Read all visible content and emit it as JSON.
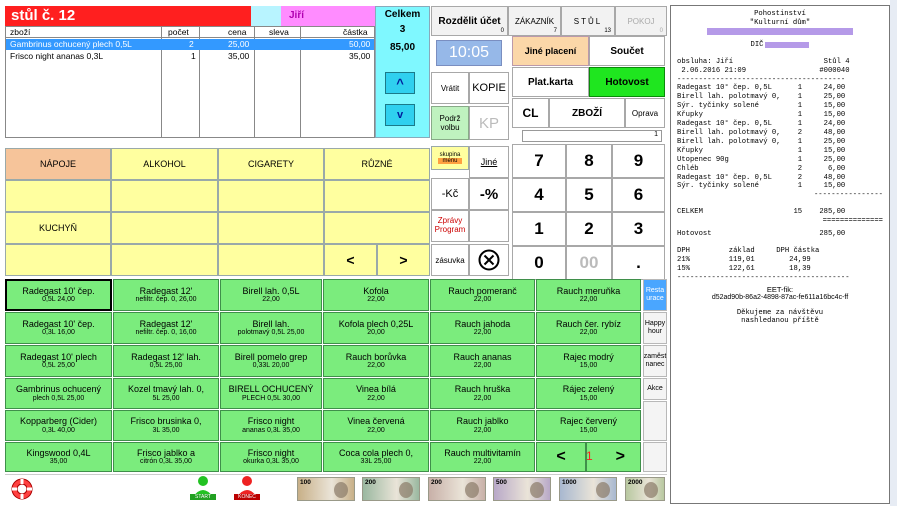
{
  "table": {
    "title": "stůl č. 12",
    "waiter": "Jiří",
    "total_label": "Celkem",
    "total_count": "3",
    "total_amount": "85,00"
  },
  "order": {
    "headers": [
      "zboží",
      "počet",
      "cena",
      "sleva",
      "částka"
    ],
    "rows": [
      [
        "Gambrinus ochucený plech 0,5L",
        "2",
        "25,00",
        "",
        "50,00"
      ],
      [
        "Frisco night ananas 0,3L",
        "1",
        "35,00",
        "",
        "35,00"
      ]
    ]
  },
  "clock": "10:05",
  "top_tabs": [
    {
      "label": "Rozdělit účet",
      "count": "0"
    },
    {
      "label": "ZÁKAZNÍK",
      "count": "7"
    },
    {
      "label": "STŮL",
      "count": "13"
    },
    {
      "label": "POKOJ",
      "count": "0"
    }
  ],
  "actions": {
    "jine_placeni": "Jiné placení",
    "soucet": "Součet",
    "plat_karta": "Plat.karta",
    "hotovost": "Hotovost",
    "vratit": "Vrátit",
    "kopie": "KOPIE",
    "podrz": "Podrž volbu",
    "kp": "KP",
    "cl": "CL",
    "zbozi": "ZBOŽÍ",
    "oprava": "Oprava",
    "skupina": "skupina",
    "menu": "menu",
    "jine": "Jiné",
    "minus_kc": "-Kč",
    "percent": "-%",
    "zpravy": "Zprávy Program",
    "zasuvka": "zásuvka",
    "input_value": "1",
    "up": "^",
    "down": "v",
    "prev": "<",
    "next": ">"
  },
  "categories": [
    "NÁPOJE",
    "ALKOHOL",
    "CIGARETY",
    "RŮZNÉ",
    "KUCHYŇ"
  ],
  "keypad": [
    "7",
    "8",
    "9",
    "4",
    "5",
    "6",
    "1",
    "2",
    "3",
    "0",
    "00",
    "."
  ],
  "products": [
    [
      {
        "n": "Radegast 10' čep.",
        "s": "0,5L   24,00"
      },
      {
        "n": "Radegast 12'",
        "s": "nefiltr. čep. 0,    26,00"
      },
      {
        "n": "Birell lah. 0,5L",
        "s": "22,00"
      },
      {
        "n": "Kofola",
        "s": "22,00"
      },
      {
        "n": "Rauch pomeranč",
        "s": "22,00"
      },
      {
        "n": "Rauch meruňka",
        "s": "22,00"
      }
    ],
    [
      {
        "n": "Radegast 10' čep.",
        "s": "0,3L   16,00"
      },
      {
        "n": "Radegast 12'",
        "s": "nefiltr. čep. 0,    16,00"
      },
      {
        "n": "Birell lah.",
        "s": "polotmavý 0,5L    25,00"
      },
      {
        "n": "Kofola plech 0,25L",
        "s": "20,00"
      },
      {
        "n": "Rauch jahoda",
        "s": "22,00"
      },
      {
        "n": "Rauch čer. rybíz",
        "s": "22,00"
      }
    ],
    [
      {
        "n": "Radegast 10' plech",
        "s": "0,5L   25,00"
      },
      {
        "n": "Radegast 12' lah.",
        "s": "0,5L   25,00"
      },
      {
        "n": "Birell pomelo grep",
        "s": "0,33L   20,00"
      },
      {
        "n": "Rauch borůvka",
        "s": "22,00"
      },
      {
        "n": "Rauch ananas",
        "s": "22,00"
      },
      {
        "n": "Rajec modrý",
        "s": "15,00"
      }
    ],
    [
      {
        "n": "Gambrinus ochucený",
        "s": "plech 0,5L   25,00"
      },
      {
        "n": "Kozel tmavý lah. 0,",
        "s": "5L   25,00"
      },
      {
        "n": "BIRELL OCHUCENÝ",
        "s": "PLECH 0,5L   30,00"
      },
      {
        "n": "Vinea bílá",
        "s": "22,00"
      },
      {
        "n": "Rauch hruška",
        "s": "22,00"
      },
      {
        "n": "Rájec zelený",
        "s": "15,00"
      }
    ],
    [
      {
        "n": "Kopparberg (Cider)",
        "s": "0,3L   40,00"
      },
      {
        "n": "Frisco brusinka 0,",
        "s": "3L   35,00"
      },
      {
        "n": "Frisco night",
        "s": "ananas 0,3L   35,00"
      },
      {
        "n": "Vinea červená",
        "s": "22,00"
      },
      {
        "n": "Rauch jablko",
        "s": "22,00"
      },
      {
        "n": "Rajec červený",
        "s": "15,00"
      }
    ],
    [
      {
        "n": "Kingswood 0,4L",
        "s": "35,00"
      },
      {
        "n": "Frisco jablko a",
        "s": "citrón 0,3L   35,00"
      },
      {
        "n": "Frisco night",
        "s": "okurka 0,3L   35,00"
      },
      {
        "n": "Coca cola plech 0,",
        "s": "33L   25,00"
      },
      {
        "n": "Rauch multivitamín",
        "s": "22,00"
      }
    ]
  ],
  "page_nav": {
    "prev": "<",
    "page": "1",
    "next": ">"
  },
  "side_buttons": [
    "Resta urace",
    "Happy hour",
    "zaměst nanec",
    "Akce"
  ],
  "bottom": {
    "start": "START",
    "konec": "KONEC",
    "notes": [
      "100",
      "200",
      "200",
      "500",
      "1000",
      "2000"
    ]
  },
  "receipt": {
    "header": [
      "Pohostinství",
      "\"Kulturní dům\""
    ],
    "dic": "DIČ",
    "info1": "obsluha: Jiří                     Stůl 4",
    "info2": " 2.06.2016 21:09                 #000040",
    "items": [
      "Radegast 10° čep. 0,5L      1     24,00",
      "Birell lah. polotmavý 0,    1     25,00",
      "Sýr. tyčinky solené         1     15,00",
      "Křupky                      1     15,00",
      "Radegast 10° čep. 0,5L      1     24,00",
      "Birell lah. polotmavý 0,    2     48,00",
      "Birell lah. polotmavý 0,    1     25,00",
      "Křupky                      1     15,00",
      "Utopenec 90g                1     25,00",
      "Chléb                       2      6,00",
      "Radegast 10° čep. 0,5L      2     48,00",
      "Sýr. tyčinky solené         1     15,00"
    ],
    "total": "CELKEM                     15    285,00",
    "paid": "Hotovost                         285,00",
    "vat_head": "DPH         základ     DPH částka",
    "vat1": "21%         119,01        24,99",
    "vat2": "15%         122,61        18,39",
    "eet_label": "EET-fik:",
    "eet_code": "d52ad90b-86a2-4898-87ac-fe611a16bc4c-ff",
    "thanks1": "Děkujeme za návštěvu",
    "thanks2": "nashledanou příště"
  },
  "colors": {
    "title_red": "#ff1f1f",
    "waiter_pink": "#ff8cff",
    "cyan": "#7ff8ff",
    "yellow": "#ffff9f",
    "green": "#7bec7d",
    "hotovost": "#1fe61f",
    "clock_blue": "#96b8e8"
  }
}
